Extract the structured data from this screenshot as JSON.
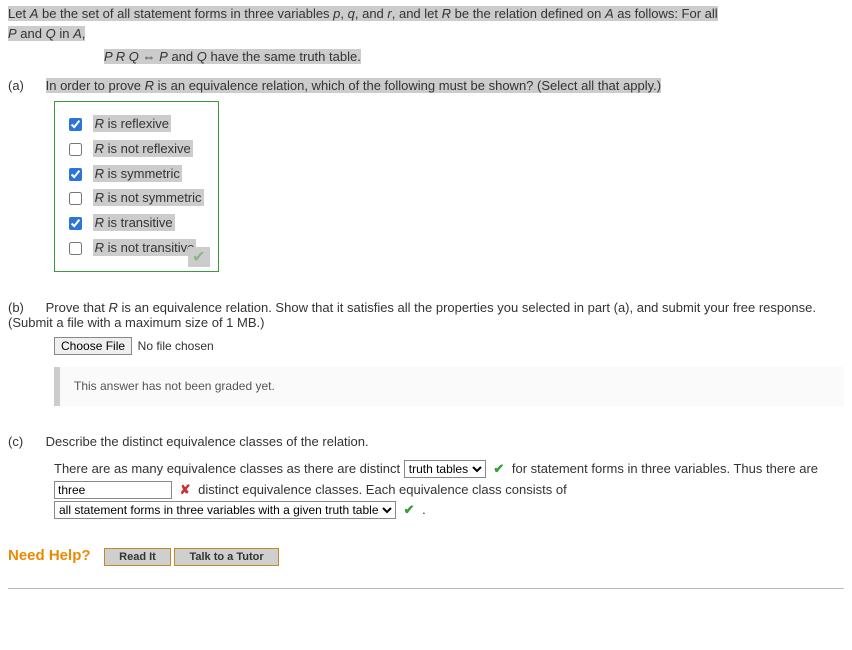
{
  "intro": {
    "l1a": "Let ",
    "A": "A",
    "l1b": " be the set of all statement forms in three variables ",
    "p": "p",
    "comma": ", ",
    "q": "q",
    "and": ", and ",
    "r": "r",
    "l1c": ", and let ",
    "R": "R",
    "l1d": " be the relation defined on ",
    "l1e": " as follows: For all",
    "l2a": "P",
    "l2b": " and ",
    "l2c": "Q",
    "l2d": " in ",
    "l2e": ","
  },
  "reldef": {
    "prq": "P R Q",
    "iff": " ⇔ ",
    "p": "P",
    "and": " and ",
    "q": "Q",
    "rest": " have the same truth table."
  },
  "parts": {
    "a": {
      "label": "(a)",
      "q1": "In order to prove ",
      "R": "R",
      "q2": " is an equivalence relation, which of the following must be shown? (Select all that apply.)",
      "options": [
        {
          "checked": true,
          "pre": "R",
          "post": " is reflexive"
        },
        {
          "checked": false,
          "pre": "R",
          "post": " is not reflexive"
        },
        {
          "checked": true,
          "pre": "R",
          "post": " is symmetric"
        },
        {
          "checked": false,
          "pre": "R",
          "post": " is not symmetric"
        },
        {
          "checked": true,
          "pre": "R",
          "post": " is transitive"
        },
        {
          "checked": false,
          "pre": "R",
          "post": " is not transitive"
        }
      ]
    },
    "b": {
      "label": "(b)",
      "t1": "Prove that ",
      "R": "R",
      "t2": " is an equivalence relation. Show that it satisfies all the properties you selected in part (a), and submit your free response. (Submit a file with a maximum size of 1 MB.)",
      "choose": "Choose File",
      "nofile": "No file chosen",
      "graded": "This answer has not been graded yet."
    },
    "c": {
      "label": "(c)",
      "heading": "Describe the distinct equivalence classes of the relation.",
      "s1": "There are as many equivalence classes as there are distinct ",
      "sel1": "truth tables",
      "s2": "   for statement forms in three variables. Thus there are ",
      "answer2": "three",
      "s3": "  distinct equivalence classes. Each equivalence class consists of ",
      "sel3": "all statement forms in three variables with a given truth table",
      "s4": "  ."
    }
  },
  "help": {
    "label": "Need Help?",
    "read": "Read It",
    "tutor": "Talk to a Tutor"
  },
  "marks": {
    "ok": "✔",
    "bad": "✘"
  }
}
